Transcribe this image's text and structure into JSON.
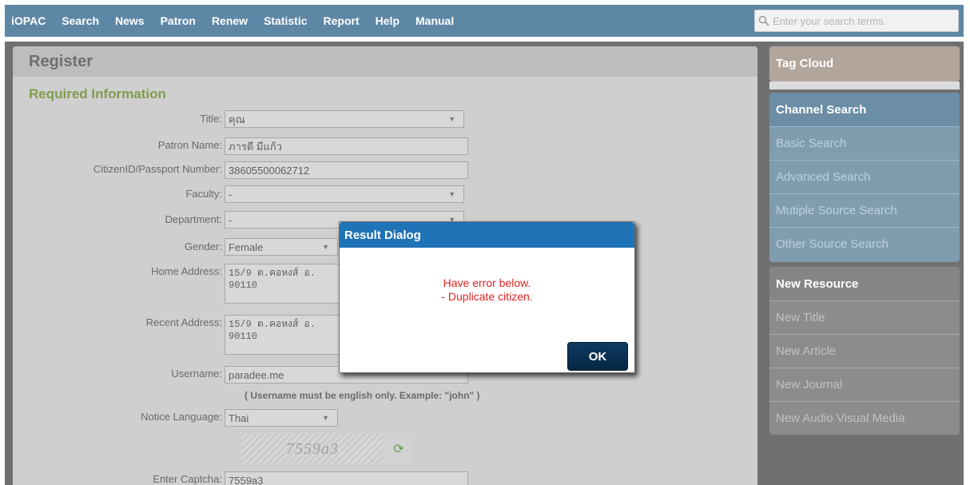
{
  "nav": {
    "items": [
      "iOPAC",
      "Search",
      "News",
      "Patron",
      "Renew",
      "Statistic",
      "Report",
      "Help",
      "Manual"
    ],
    "search_placeholder": "Enter your search terms."
  },
  "main": {
    "title": "Register",
    "section": "Required Information",
    "fields": {
      "title": {
        "label": "Title:",
        "value": "คุณ"
      },
      "patron_name": {
        "label": "Patron Name:",
        "value": "ภารดี มีแก้ว"
      },
      "citizen_id": {
        "label": "CitizenID/Passport Number:",
        "value": "38605500062712"
      },
      "faculty": {
        "label": "Faculty:",
        "value": "-"
      },
      "department": {
        "label": "Department:",
        "value": "-"
      },
      "gender": {
        "label": "Gender:",
        "value": "Female"
      },
      "home_address": {
        "label": "Home Address:",
        "value": "15/9 ต.คอหงส์ อ.\n90110"
      },
      "recent_address": {
        "label": "Recent Address:",
        "value": "15/9 ต.คอหงส์ อ.\n90110"
      },
      "username": {
        "label": "Username:",
        "value": "paradee.me"
      },
      "username_hint": "( Username must be english only. Example: \"john\" )",
      "notice_language": {
        "label": "Notice Language:",
        "value": "Thai"
      },
      "captcha_image_text": "7559a3",
      "captcha": {
        "label": "Enter Captcha:",
        "value": "7559a3"
      }
    }
  },
  "sidebar": {
    "tag_cloud": "Tag Cloud",
    "channel_search": {
      "header": "Channel Search",
      "items": [
        "Basic Search",
        "Advanced Search",
        "Mutiple Source Search",
        "Other Source Search"
      ]
    },
    "new_resource": {
      "header": "New Resource",
      "items": [
        "New Title",
        "New Article",
        "New Journal",
        "New Audio Visual Media"
      ]
    }
  },
  "dialog": {
    "title": "Result Dialog",
    "line1": "Have error below.",
    "line2": "- Duplicate citizen.",
    "ok": "OK"
  }
}
